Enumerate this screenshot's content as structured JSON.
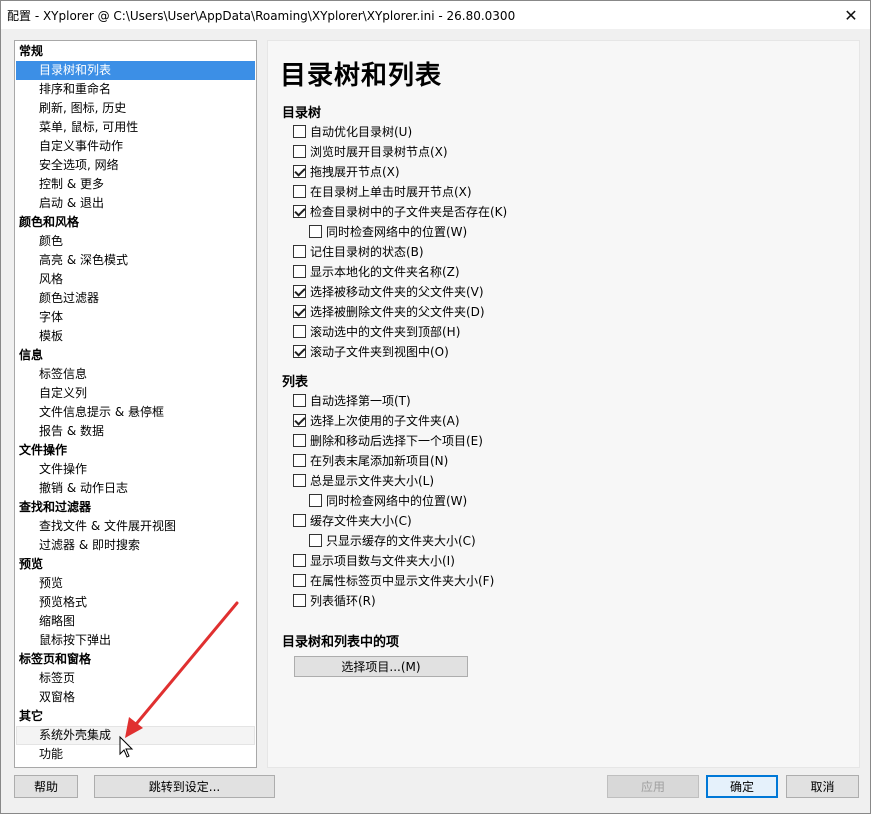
{
  "window": {
    "title": "配置 - XYplorer @ C:\\Users\\User\\AppData\\Roaming\\XYplorer\\XYplorer.ini - 26.80.0300",
    "close_glyph": "✕"
  },
  "tree": [
    {
      "type": "cat",
      "label": "常规"
    },
    {
      "type": "item",
      "label": "目录树和列表",
      "state": "selected"
    },
    {
      "type": "item",
      "label": "排序和重命名"
    },
    {
      "type": "item",
      "label": "刷新, 图标, 历史"
    },
    {
      "type": "item",
      "label": "菜单, 鼠标, 可用性"
    },
    {
      "type": "item",
      "label": "自定义事件动作"
    },
    {
      "type": "item",
      "label": "安全选项, 网络"
    },
    {
      "type": "item",
      "label": "控制 & 更多"
    },
    {
      "type": "item",
      "label": "启动 & 退出"
    },
    {
      "type": "cat",
      "label": "颜色和风格"
    },
    {
      "type": "item",
      "label": "颜色"
    },
    {
      "type": "item",
      "label": "高亮 & 深色模式"
    },
    {
      "type": "item",
      "label": "风格"
    },
    {
      "type": "item",
      "label": "颜色过滤器"
    },
    {
      "type": "item",
      "label": "字体"
    },
    {
      "type": "item",
      "label": "模板"
    },
    {
      "type": "cat",
      "label": "信息"
    },
    {
      "type": "item",
      "label": "标签信息"
    },
    {
      "type": "item",
      "label": "自定义列"
    },
    {
      "type": "item",
      "label": "文件信息提示 & 悬停框"
    },
    {
      "type": "item",
      "label": "报告 & 数据"
    },
    {
      "type": "cat",
      "label": "文件操作"
    },
    {
      "type": "item",
      "label": "文件操作"
    },
    {
      "type": "item",
      "label": "撤销 & 动作日志"
    },
    {
      "type": "cat",
      "label": "查找和过滤器"
    },
    {
      "type": "item",
      "label": "查找文件 & 文件展开视图"
    },
    {
      "type": "item",
      "label": "过滤器 & 即时搜索"
    },
    {
      "type": "cat",
      "label": "预览"
    },
    {
      "type": "item",
      "label": "预览"
    },
    {
      "type": "item",
      "label": "预览格式"
    },
    {
      "type": "item",
      "label": "缩略图"
    },
    {
      "type": "item",
      "label": "鼠标按下弹出"
    },
    {
      "type": "cat",
      "label": "标签页和窗格"
    },
    {
      "type": "item",
      "label": "标签页"
    },
    {
      "type": "item",
      "label": "双窗格"
    },
    {
      "type": "cat",
      "label": "其它"
    },
    {
      "type": "item",
      "label": "系统外壳集成",
      "state": "hover"
    },
    {
      "type": "item",
      "label": "功能"
    }
  ],
  "panel": {
    "heading": "目录树和列表",
    "sections": [
      {
        "title": "目录树",
        "options": [
          {
            "label": "自动优化目录树(U)",
            "checked": false,
            "indent": 0
          },
          {
            "label": "浏览时展开目录树节点(X)",
            "checked": false,
            "indent": 0
          },
          {
            "label": "拖拽展开节点(X)",
            "checked": true,
            "indent": 0
          },
          {
            "label": "在目录树上单击时展开节点(X)",
            "checked": false,
            "indent": 0
          },
          {
            "label": "检查目录树中的子文件夹是否存在(K)",
            "checked": true,
            "indent": 0
          },
          {
            "label": "同时检查网络中的位置(W)",
            "checked": false,
            "indent": 1
          },
          {
            "label": "记住目录树的状态(B)",
            "checked": false,
            "indent": 0
          },
          {
            "label": "显示本地化的文件夹名称(Z)",
            "checked": false,
            "indent": 0
          },
          {
            "label": "选择被移动文件夹的父文件夹(V)",
            "checked": true,
            "indent": 0
          },
          {
            "label": "选择被删除文件夹的父文件夹(D)",
            "checked": true,
            "indent": 0
          },
          {
            "label": "滚动选中的文件夹到顶部(H)",
            "checked": false,
            "indent": 0
          },
          {
            "label": "滚动子文件夹到视图中(O)",
            "checked": true,
            "indent": 0
          }
        ]
      },
      {
        "title": "列表",
        "options": [
          {
            "label": "自动选择第一项(T)",
            "checked": false,
            "indent": 0
          },
          {
            "label": "选择上次使用的子文件夹(A)",
            "checked": true,
            "indent": 0
          },
          {
            "label": "删除和移动后选择下一个项目(E)",
            "checked": false,
            "indent": 0
          },
          {
            "label": "在列表末尾添加新项目(N)",
            "checked": false,
            "indent": 0
          },
          {
            "label": "总是显示文件夹大小(L)",
            "checked": false,
            "indent": 0
          },
          {
            "label": "同时检查网络中的位置(W)",
            "checked": false,
            "indent": 1
          },
          {
            "label": "缓存文件夹大小(C)",
            "checked": false,
            "indent": 0
          },
          {
            "label": "只显示缓存的文件夹大小(C)",
            "checked": false,
            "indent": 1
          },
          {
            "label": "显示项目数与文件夹大小(I)",
            "checked": false,
            "indent": 0
          },
          {
            "label": "在属性标签页中显示文件夹大小(F)",
            "checked": false,
            "indent": 0
          },
          {
            "label": "列表循环(R)",
            "checked": false,
            "indent": 0
          }
        ]
      }
    ],
    "items_section_title": "目录树和列表中的项",
    "select_items_button": "选择项目...(M)"
  },
  "footer": {
    "help": "帮助",
    "jump": "跳转到设定...",
    "apply": "应用",
    "ok": "确定",
    "cancel": "取消"
  },
  "annotation": {
    "arrow_color": "#e03030"
  }
}
